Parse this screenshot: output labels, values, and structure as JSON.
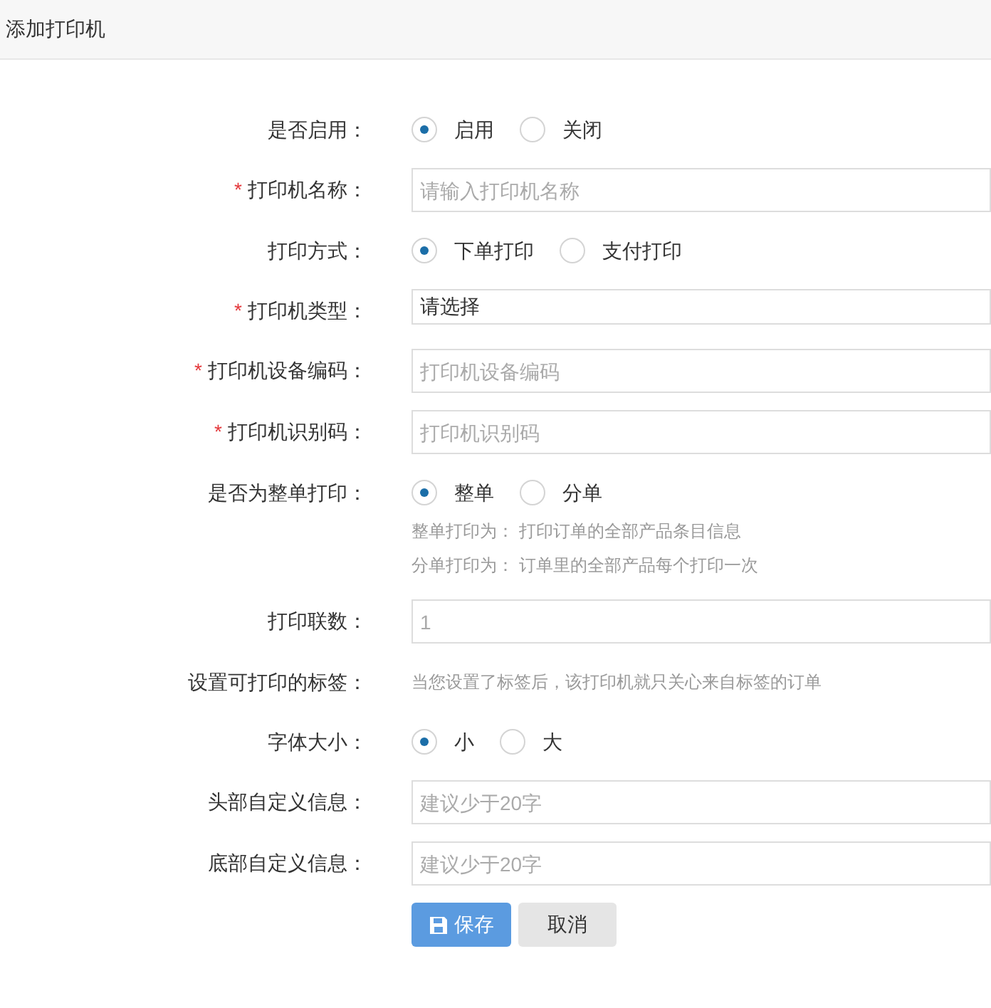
{
  "header": {
    "title": "添加打印机"
  },
  "rows": [
    {
      "kind": "radio",
      "label": "是否启用：",
      "options": [
        {
          "label": "启用",
          "selected": true
        },
        {
          "label": "关闭",
          "selected": false
        }
      ]
    },
    {
      "kind": "input",
      "label": "打印机名称：",
      "required_mark": "*",
      "placeholder": "请输入打印机名称"
    },
    {
      "kind": "radio",
      "label": "打印方式：",
      "options": [
        {
          "label": "下单打印",
          "selected": true
        },
        {
          "label": "支付打印",
          "selected": false
        }
      ]
    },
    {
      "kind": "select",
      "label": "打印机类型：",
      "required_mark": "*",
      "value": "请选择"
    },
    {
      "kind": "input",
      "label": "打印机设备编码：",
      "required_mark": "*",
      "placeholder": "打印机设备编码"
    },
    {
      "kind": "input",
      "label": "打印机识别码：",
      "required_mark": "*",
      "placeholder": "打印机识别码"
    },
    {
      "kind": "radio",
      "label": "是否为整单打印：",
      "options": [
        {
          "label": "整单",
          "selected": true
        },
        {
          "label": "分单",
          "selected": false
        }
      ],
      "hints": [
        "整单打印为： 打印订单的全部产品条目信息",
        "分单打印为： 订单里的全部产品每个打印一次"
      ]
    },
    {
      "kind": "input",
      "label": "打印联数：",
      "placeholder": "1"
    },
    {
      "kind": "text",
      "label": "设置可打印的标签：",
      "text": "当您设置了标签后，该打印机就只关心来自标签的订单"
    },
    {
      "kind": "radio",
      "label": "字体大小：",
      "options": [
        {
          "label": "小",
          "selected": true
        },
        {
          "label": "大",
          "selected": false
        }
      ]
    },
    {
      "kind": "input",
      "label": "头部自定义信息：",
      "placeholder": "建议少于20字"
    },
    {
      "kind": "input",
      "label": "底部自定义信息：",
      "placeholder": "建议少于20字"
    }
  ],
  "buttons": {
    "save": "保存",
    "cancel": "取消"
  }
}
